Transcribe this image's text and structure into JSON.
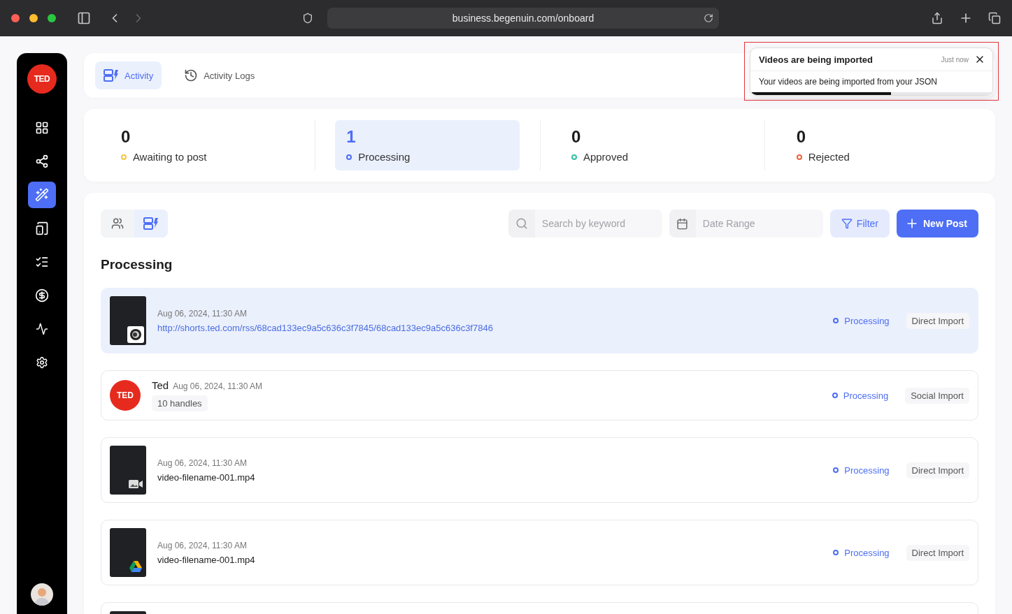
{
  "browser": {
    "url": "business.begenuin.com/onboard"
  },
  "sidebar": {
    "logo": "TED",
    "items": [
      {
        "selected": false
      },
      {
        "selected": false
      },
      {
        "selected": true
      },
      {
        "selected": false
      },
      {
        "selected": false
      },
      {
        "selected": false
      },
      {
        "selected": false
      },
      {
        "selected": false
      }
    ]
  },
  "tabs": [
    {
      "label": "Activity",
      "selected": true
    },
    {
      "label": "Activity Logs",
      "selected": false
    }
  ],
  "stats": [
    {
      "value": "0",
      "label": "Awaiting to post",
      "color": "#f5c542",
      "selected": false
    },
    {
      "value": "1",
      "label": "Processing",
      "color": "#4d6ef5",
      "selected": true
    },
    {
      "value": "0",
      "label": "Approved",
      "color": "#35c0a5",
      "selected": false
    },
    {
      "value": "0",
      "label": "Rejected",
      "color": "#f0623d",
      "selected": false
    }
  ],
  "view_toggle": [
    {
      "selected": false
    },
    {
      "selected": true
    }
  ],
  "search": {
    "placeholder": "Search by keyword"
  },
  "date_range": {
    "placeholder": "Date Range"
  },
  "filter_button": "Filter",
  "new_post_button": "New Post",
  "section_title": "Processing",
  "posts": [
    {
      "kind": "link",
      "date": "Aug 06, 2024, 11:30 AM",
      "title": "http://shorts.ted.com/rss/68cad133ec9a5c636c3f7845/68cad133ec9a5c636c3f7846",
      "status": "Processing",
      "source": "Direct Import",
      "selected": true
    },
    {
      "kind": "social",
      "avatar": "TED",
      "name": "Ted",
      "date": "Aug 06, 2024, 11:30 AM",
      "handles": "10 handles",
      "status": "Processing",
      "source": "Social Import",
      "selected": false
    },
    {
      "kind": "upload",
      "date": "Aug 06, 2024, 11:30 AM",
      "title": "video-filename-001.mp4",
      "status": "Processing",
      "source": "Direct Import",
      "selected": false
    },
    {
      "kind": "drive",
      "date": "Aug 06, 2024, 11:30 AM",
      "title": "video-filename-001.mp4",
      "status": "Processing",
      "source": "Direct Import",
      "selected": false
    }
  ],
  "more_below": true,
  "toast": {
    "title": "Videos are being imported",
    "time": "Just now",
    "message": "Your videos are being imported from your JSON",
    "level": 0.58,
    "highlighted": true
  }
}
